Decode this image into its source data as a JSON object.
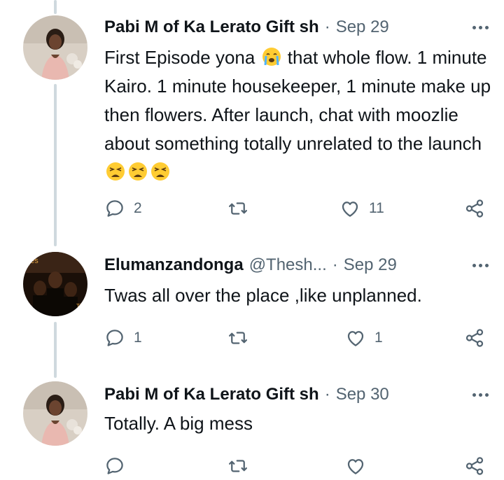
{
  "tweets": [
    {
      "author": "Pabi M of Ka Lerato Gift sh",
      "handle": "",
      "separator": "·",
      "date": "Sep 29",
      "text_part1": "First Episode yona",
      "text_part2": "that whole flow. 1 minute Kairo. 1 minute housekeeper, 1 minute make up then flowers. After launch, chat with moozlie about something totally unrelated to the launch",
      "emojis": [
        "crying-face-emoji",
        "weary-face-emoji",
        "weary-face-emoji",
        "weary-face-emoji"
      ],
      "reply_count": "2",
      "retweet_count": "",
      "like_count": "11"
    },
    {
      "author": "Elumanzandonga",
      "handle": "@Thesh...",
      "separator": "·",
      "date": "Sep 29",
      "text": "Twas all over the place ,like unplanned.",
      "reply_count": "1",
      "retweet_count": "",
      "like_count": "1"
    },
    {
      "author": "Pabi M of Ka Lerato Gift sh",
      "handle": "",
      "separator": "·",
      "date": "Sep 30",
      "text": "Totally. A big mess",
      "reply_count": "",
      "retweet_count": "",
      "like_count": ""
    }
  ],
  "icons": [
    "more-icon",
    "reply-icon",
    "retweet-icon",
    "like-icon",
    "share-icon"
  ],
  "colors": {
    "text": "#0f1419",
    "muted": "#536471",
    "thread_line": "#cfd9de"
  }
}
